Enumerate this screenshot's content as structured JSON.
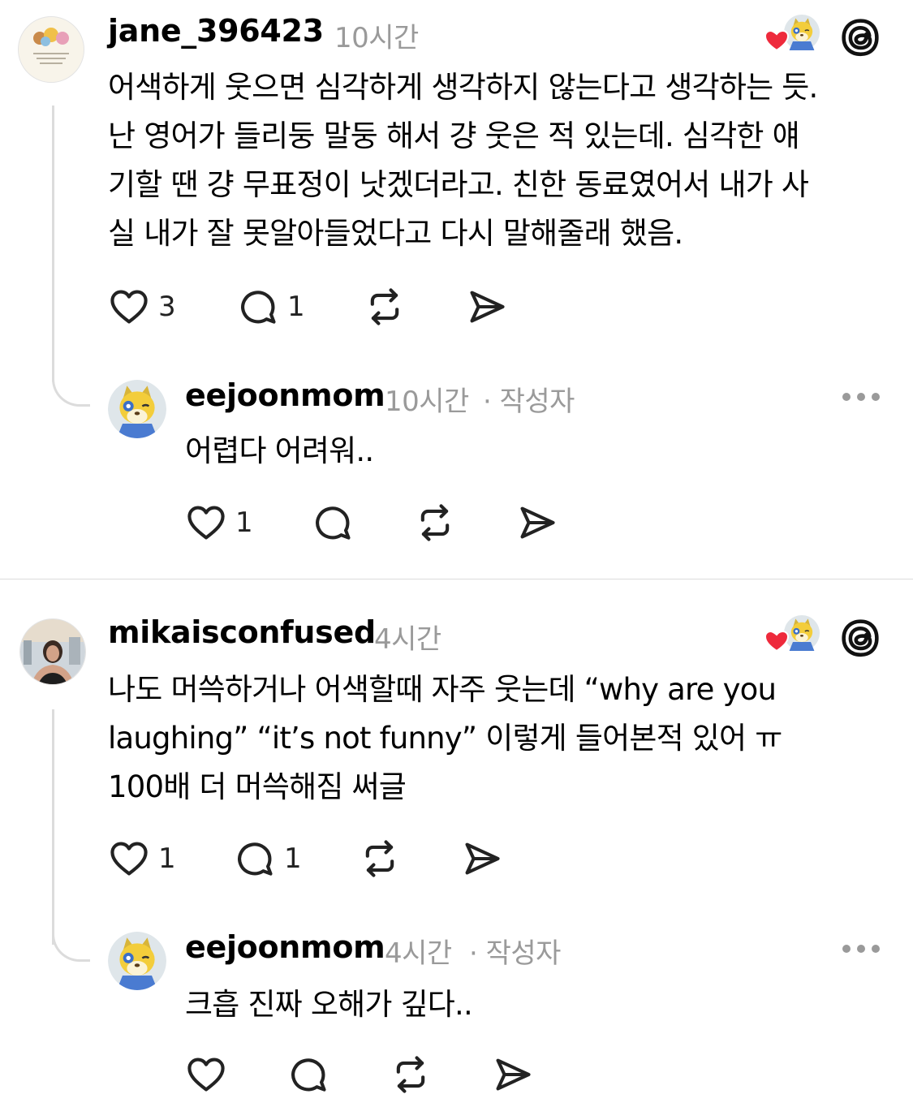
{
  "posts": [
    {
      "username": "jane_396423",
      "time": "10시간",
      "text": "어색하게 웃으면 심각하게 생각하지 않는다고 생각하는 듯.\n난 영어가 들리둥 말둥 해서 걍 웃은 적 있는데. 심각한 얘\n기할 땐 걍 무표정이 낫겠더라고. 친한 동료였어서 내가 사\n실 내가 잘 못알아들었다고 다시 말해줄래 했음.",
      "likes": "3",
      "replies": "1",
      "reply": {
        "username": "eejoonmom",
        "time": "10시간",
        "author_tag": "· 작성자",
        "text": "어렵다 어려워..",
        "likes": "1"
      }
    },
    {
      "username": "mikaisconfused",
      "time": "4시간",
      "text": "나도 머쓱하거나 어색할때 자주 웃는데 “why are you\nlaughing” “it’s not funny” 이렇게 들어본적 있어 ㅠ\n100배 더 머쓱해짐 써글",
      "likes": "1",
      "replies": "1",
      "reply": {
        "username": "eejoonmom",
        "time": "4시간",
        "author_tag": "· 작성자",
        "text": "크흡 진짜 오해가 깊다..",
        "likes": ""
      }
    }
  ],
  "icons": {
    "like": "heart-icon",
    "reply": "comment-icon",
    "repost": "repost-icon",
    "share": "send-icon",
    "more": "more-dots-icon",
    "threads": "threads-logo-icon",
    "liked_by_author": "liked-by-author-icon"
  },
  "colors": {
    "heart_red": "#ee2a3c",
    "muted": "#9a9a9a",
    "line": "#dcdcdc"
  }
}
